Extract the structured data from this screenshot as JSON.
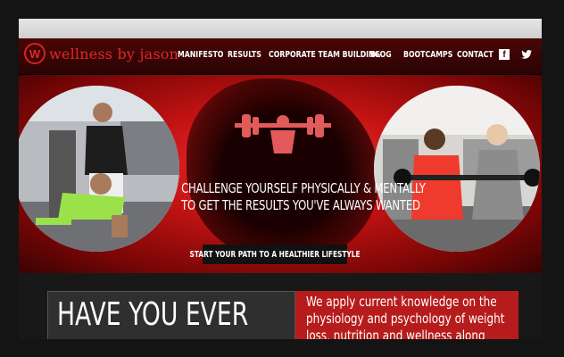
{
  "brand": {
    "name": "wellness by jason",
    "mark": "W"
  },
  "nav": {
    "items": [
      "MANIFESTO",
      "RESULTS",
      "CORPORATE TEAM BUILDING",
      "BLOG",
      "BOOTCAMPS",
      "CONTACT"
    ],
    "social": [
      "facebook-icon",
      "twitter-icon"
    ]
  },
  "hero": {
    "headline_line1": "CHALLENGE YOURSELF PHYSICALLY & MENTALLY",
    "headline_line2": "TO GET THE RESULTS YOU'VE ALWAYS WANTED",
    "cta": "START YOUR PATH TO A HEALTHIER LIFESTYLE"
  },
  "intro": {
    "heading": "HAVE YOU EVER",
    "body": "We apply current knowledge on the physiology and psychology of weight loss, nutrition and wellness along with"
  },
  "colors": {
    "accent": "#e02828",
    "hero_red": "#c01212",
    "panel_red": "#b71c1c"
  }
}
